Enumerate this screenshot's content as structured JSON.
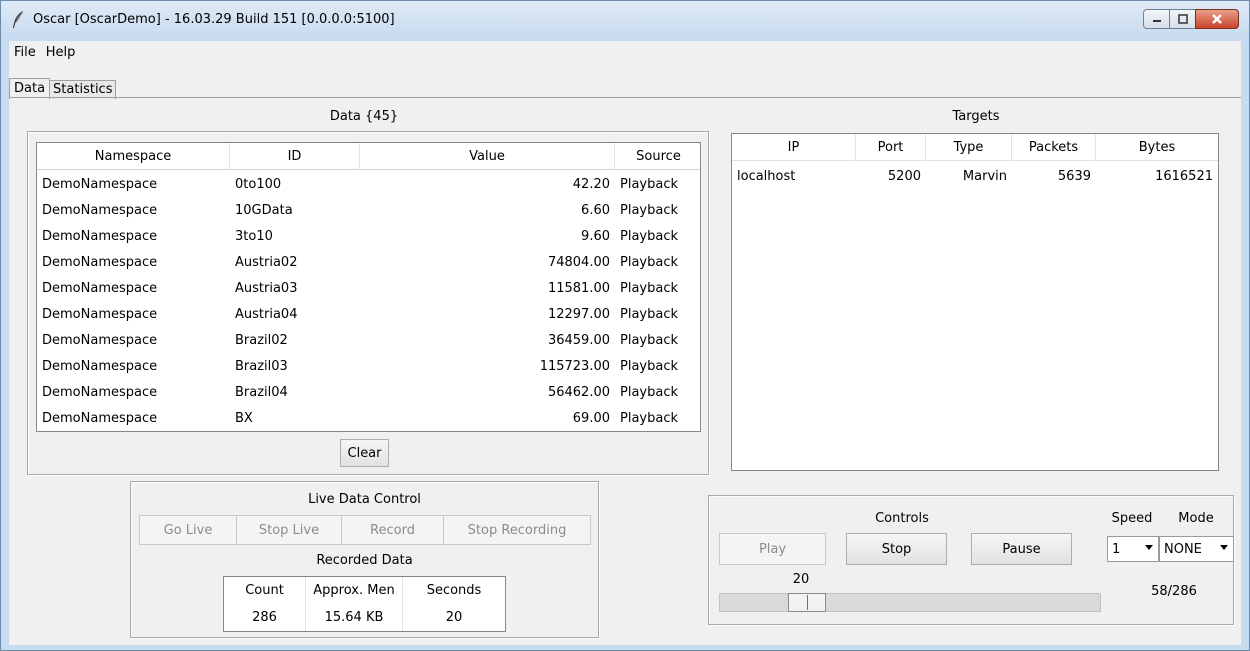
{
  "window": {
    "title": "Oscar [OscarDemo] - 16.03.29 Build 151 [0.0.0.0:5100]"
  },
  "menu": [
    "File",
    "Help"
  ],
  "tabs": [
    "Data",
    "Statistics"
  ],
  "data_panel": {
    "title": "Data {45}",
    "columns": [
      "Namespace",
      "ID",
      "Value",
      "Source"
    ],
    "rows": [
      [
        "DemoNamespace",
        "0to100",
        "42.20",
        "Playback"
      ],
      [
        "DemoNamespace",
        "10GData",
        "6.60",
        "Playback"
      ],
      [
        "DemoNamespace",
        "3to10",
        "9.60",
        "Playback"
      ],
      [
        "DemoNamespace",
        "Austria02",
        "74804.00",
        "Playback"
      ],
      [
        "DemoNamespace",
        "Austria03",
        "11581.00",
        "Playback"
      ],
      [
        "DemoNamespace",
        "Austria04",
        "12297.00",
        "Playback"
      ],
      [
        "DemoNamespace",
        "Brazil02",
        "36459.00",
        "Playback"
      ],
      [
        "DemoNamespace",
        "Brazil03",
        "115723.00",
        "Playback"
      ],
      [
        "DemoNamespace",
        "Brazil04",
        "56462.00",
        "Playback"
      ],
      [
        "DemoNamespace",
        "BX",
        "69.00",
        "Playback"
      ]
    ],
    "clear_label": "Clear"
  },
  "targets_panel": {
    "title": "Targets",
    "columns": [
      "IP",
      "Port",
      "Type",
      "Packets",
      "Bytes"
    ],
    "rows": [
      [
        "localhost",
        "5200",
        "Marvin",
        "5639",
        "1616521"
      ]
    ]
  },
  "live_control": {
    "title": "Live Data Control",
    "buttons": [
      "Go Live",
      "Stop Live",
      "Record",
      "Stop Recording"
    ],
    "recorded_title": "Recorded Data",
    "recorded_columns": [
      "Count",
      "Approx. Men",
      "Seconds"
    ],
    "recorded_values": [
      "286",
      "15.64 KB",
      "20"
    ]
  },
  "controls": {
    "title": "Controls",
    "play_label": "Play",
    "stop_label": "Stop",
    "pause_label": "Pause",
    "speed_label": "Speed",
    "mode_label": "Mode",
    "speed_value": "1",
    "mode_value": "NONE",
    "slider_value_label": "20",
    "slider_fraction": 0.2,
    "progress_text": "58/286"
  }
}
